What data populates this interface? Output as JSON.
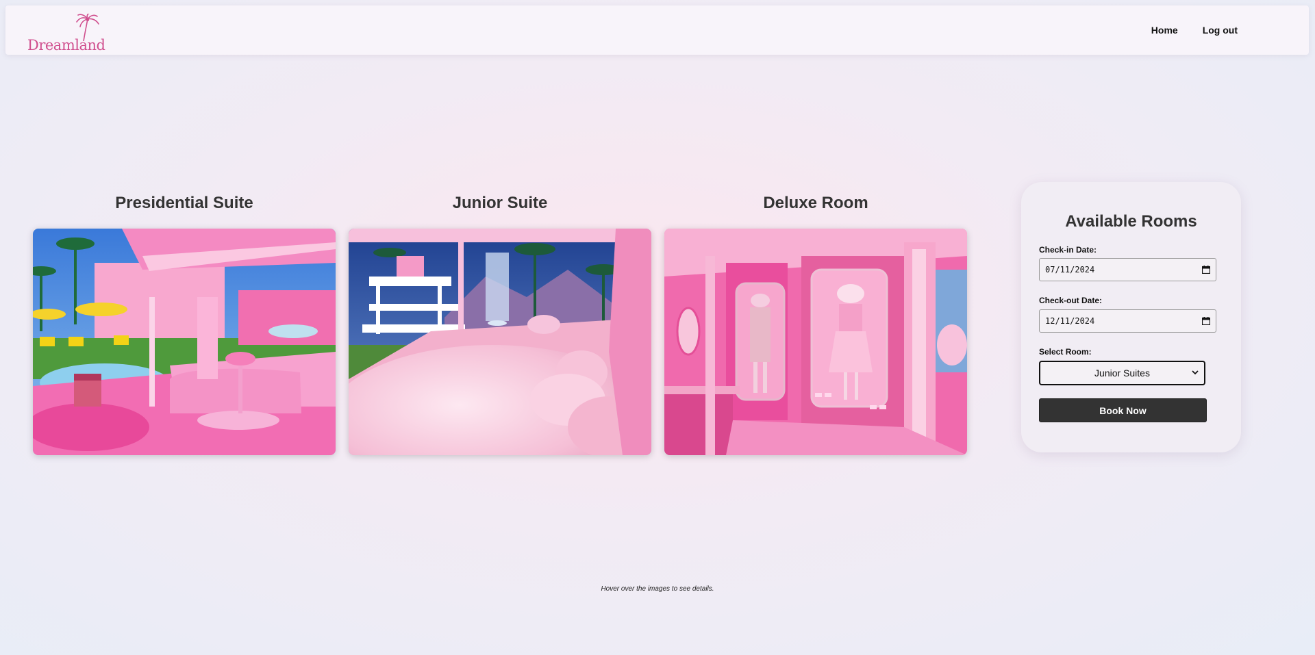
{
  "header": {
    "logo_text": "Dreamland",
    "nav": [
      {
        "label": "Home"
      },
      {
        "label": "Log out"
      }
    ]
  },
  "rooms": [
    {
      "title": "Presidential Suite",
      "image": "pink-outdoor-lounge-pool-photo"
    },
    {
      "title": "Junior Suite",
      "image": "pink-dreamhouse-glitter-bed-photo"
    },
    {
      "title": "Deluxe Room",
      "image": "pink-closet-dressing-room-photo"
    }
  ],
  "booking": {
    "title": "Available Rooms",
    "checkin_label": "Check-in Date:",
    "checkin_value": "07/11/2024",
    "checkout_label": "Check-out Date:",
    "checkout_value": "12/11/2024",
    "room_label": "Select Room:",
    "room_selected": "Junior Suites",
    "book_label": "Book Now"
  },
  "footer": {
    "note": "Hover over the images to see details."
  },
  "colors": {
    "brand_pink": "#d04f8e",
    "button_dark": "#333333",
    "panel_bg": "#f1edf4"
  }
}
